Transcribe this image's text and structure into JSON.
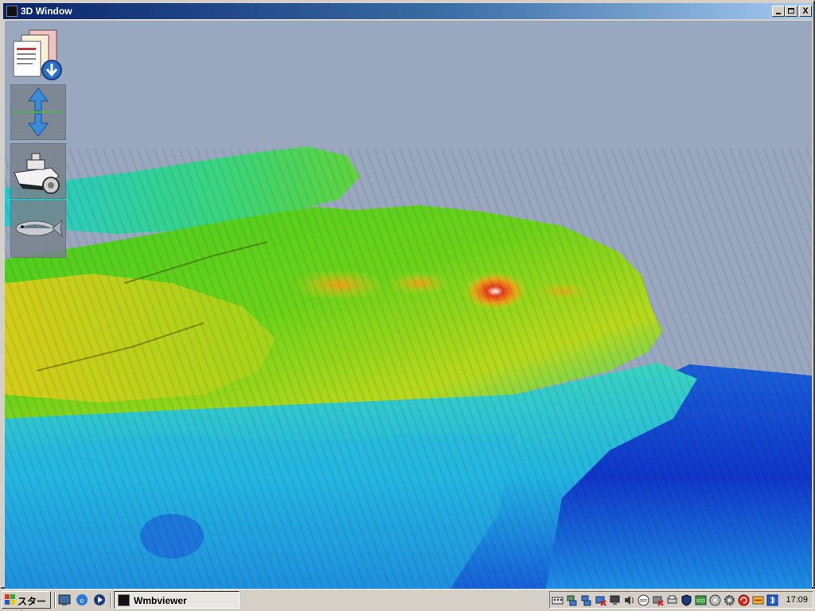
{
  "window": {
    "title": "3D Window",
    "controls": {
      "minimize": "minimize-icon",
      "maximize": "maximize-icon",
      "close": "close-icon",
      "close_glyph": "X"
    }
  },
  "viewport": {
    "sky_color": "#9aa8bf",
    "colormap": [
      "#0a2fd0",
      "#1a7ae0",
      "#25c8e0",
      "#30d870",
      "#44c81a",
      "#a6d81a",
      "#e0d41a",
      "#f08a1a",
      "#e02a10",
      "#ffffff"
    ]
  },
  "toolbar": {
    "tools": [
      {
        "name": "file-open-icon"
      },
      {
        "name": "vertical-exaggeration-icon"
      },
      {
        "name": "ship-settings-icon"
      },
      {
        "name": "fish-icon"
      }
    ]
  },
  "taskbar": {
    "start_label": "スタート",
    "quick_launch": [
      "desktop-icon",
      "ie-icon",
      "media-player-icon"
    ],
    "task_label": "Wmbviewer",
    "clock": "17:09",
    "tray_icons": [
      "keyboard-icon",
      "network-icon",
      "network-icon",
      "network-error-icon",
      "monitor-icon",
      "volume-icon",
      "off-icon",
      "network-error-icon",
      "printer-icon",
      "security-icon",
      "eco-icon",
      "disc-icon",
      "gear-icon",
      "update-icon",
      "antivirus-icon",
      "sync-icon",
      "bluetooth-icon"
    ]
  }
}
